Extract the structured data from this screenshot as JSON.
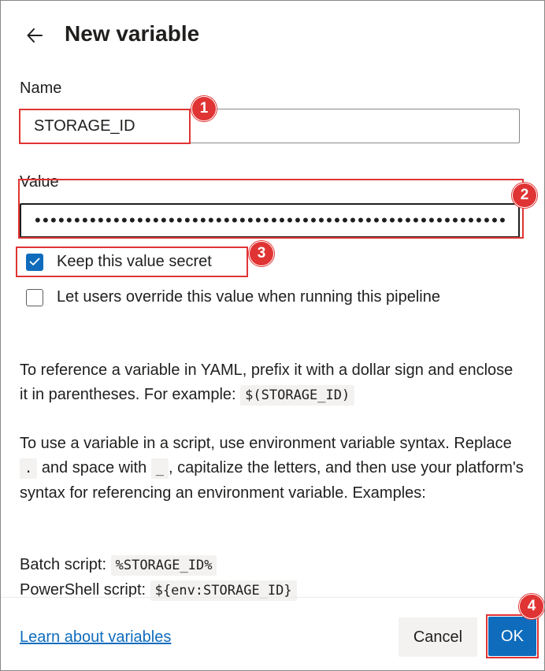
{
  "header": {
    "title": "New variable",
    "back_icon": "arrow-left-icon"
  },
  "name_field": {
    "label": "Name",
    "value": "STORAGE_ID"
  },
  "value_field": {
    "label": "Value",
    "masked_value": "••••••••••••••••••••••••••••••••••••••••••••••••••••••••••••"
  },
  "options": {
    "keep_secret": {
      "label": "Keep this value secret",
      "checked": true
    },
    "allow_override": {
      "label": "Let users override this value when running this pipeline",
      "checked": false
    }
  },
  "help": {
    "yaml_text": "To reference a variable in YAML, prefix it with a dollar sign and enclose it in parentheses. For example:",
    "yaml_example": "$(STORAGE_ID)",
    "script_text_1": "To use a variable in a script, use environment variable syntax. Replace",
    "script_dot": ".",
    "script_text_2": "and space with",
    "script_underscore": "_",
    "script_text_3": ", capitalize the letters, and then use your platform's syntax for referencing an environment variable. Examples:",
    "batch_label": "Batch script:",
    "batch_example": "%STORAGE_ID%",
    "powershell_label": "PowerShell script:",
    "powershell_example": "${env:STORAGE_ID}"
  },
  "footer": {
    "learn_link": "Learn about variables",
    "cancel_label": "Cancel",
    "ok_label": "OK"
  },
  "annotations": {
    "badge_1": "1",
    "badge_2": "2",
    "badge_3": "3",
    "badge_4": "4"
  },
  "colors": {
    "accent": "#0f6cbd",
    "annotation_red": "#e03434"
  }
}
